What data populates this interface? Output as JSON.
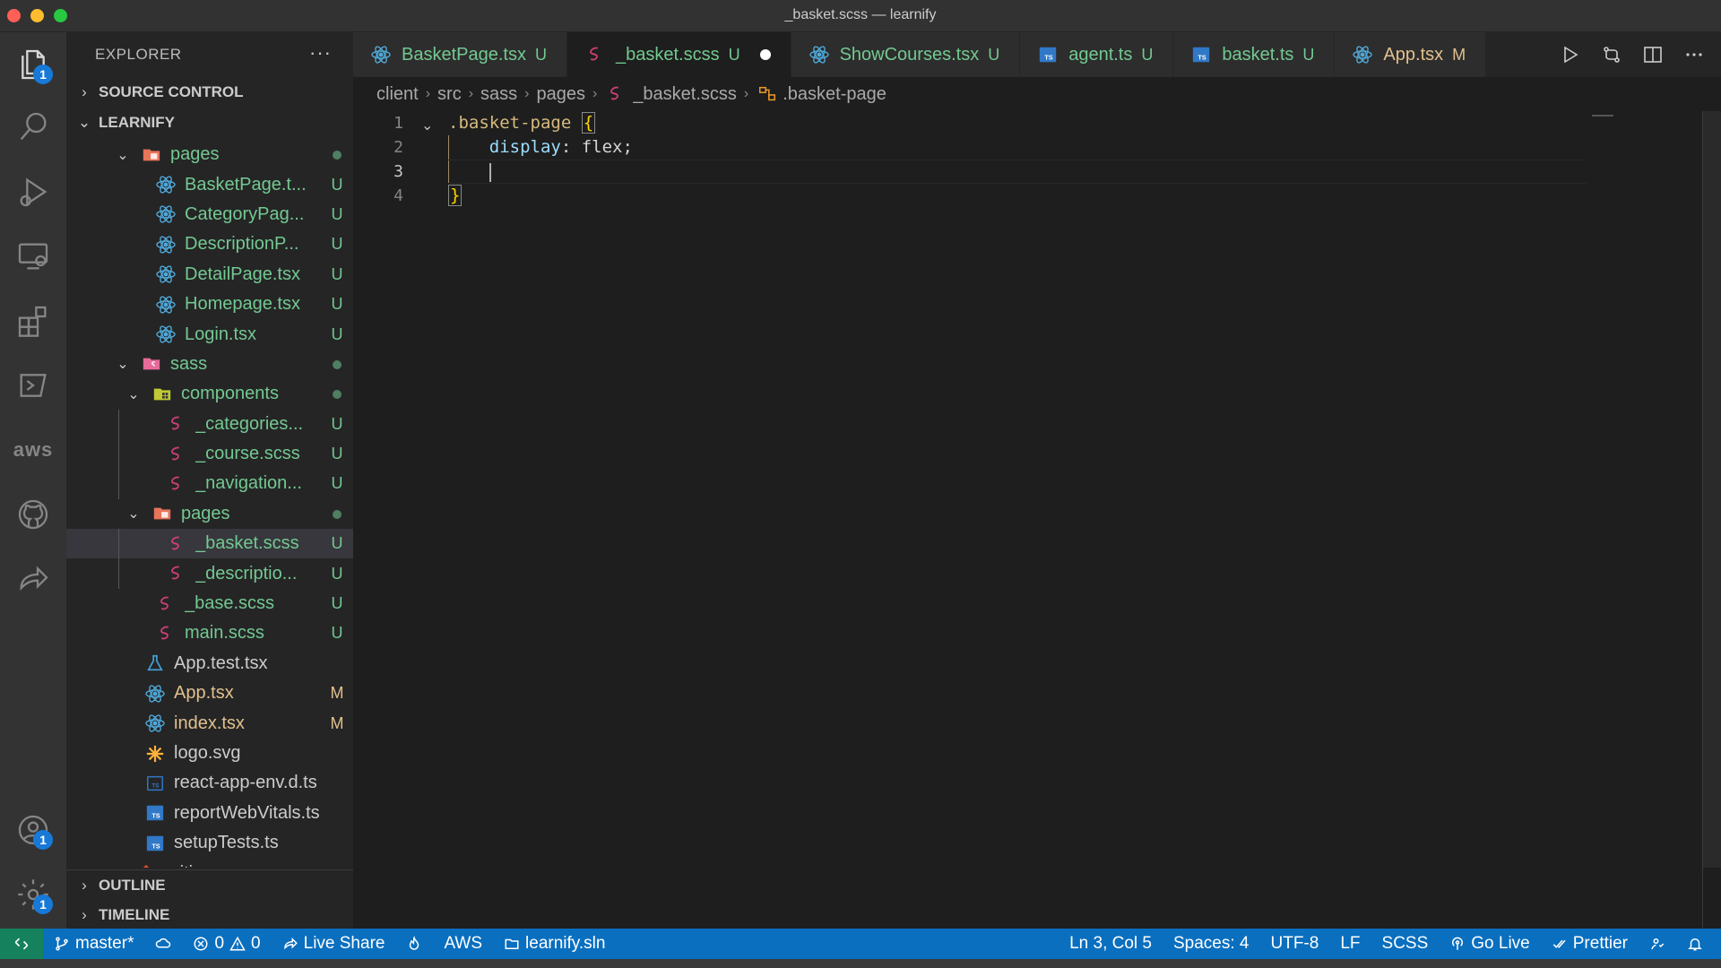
{
  "window": {
    "title": "_basket.scss — learnify"
  },
  "activity_bar": {
    "explorer_badge": "1",
    "aws_label": "aws",
    "accounts_badge": "1",
    "settings_badge": "1"
  },
  "sidebar": {
    "header": "EXPLORER",
    "more": "···",
    "source_control": "SOURCE CONTROL",
    "project": "LEARNIFY",
    "outline": "OUTLINE",
    "timeline": "TIMELINE",
    "tree": [
      {
        "name": "pages",
        "status": "",
        "kind": "folder-pages"
      },
      {
        "name": "BasketPage.t...",
        "status": "U",
        "kind": "react"
      },
      {
        "name": "CategoryPag...",
        "status": "U",
        "kind": "react"
      },
      {
        "name": "DescriptionP...",
        "status": "U",
        "kind": "react"
      },
      {
        "name": "DetailPage.tsx",
        "status": "U",
        "kind": "react"
      },
      {
        "name": "Homepage.tsx",
        "status": "U",
        "kind": "react"
      },
      {
        "name": "Login.tsx",
        "status": "U",
        "kind": "react"
      },
      {
        "name": "sass",
        "status": "",
        "kind": "folder-sass"
      },
      {
        "name": "components",
        "status": "",
        "kind": "folder-components"
      },
      {
        "name": "_categories...",
        "status": "U",
        "kind": "sass"
      },
      {
        "name": "_course.scss",
        "status": "U",
        "kind": "sass"
      },
      {
        "name": "_navigation...",
        "status": "U",
        "kind": "sass"
      },
      {
        "name": "pages",
        "status": "",
        "kind": "folder-pages"
      },
      {
        "name": "_basket.scss",
        "status": "U",
        "kind": "sass"
      },
      {
        "name": "_descriptio...",
        "status": "U",
        "kind": "sass"
      },
      {
        "name": "_base.scss",
        "status": "U",
        "kind": "sass"
      },
      {
        "name": "main.scss",
        "status": "U",
        "kind": "sass"
      },
      {
        "name": "App.test.tsx",
        "status": "",
        "kind": "test"
      },
      {
        "name": "App.tsx",
        "status": "M",
        "kind": "react"
      },
      {
        "name": "index.tsx",
        "status": "M",
        "kind": "react"
      },
      {
        "name": "logo.svg",
        "status": "",
        "kind": "svg"
      },
      {
        "name": "react-app-env.d.ts",
        "status": "",
        "kind": "ts-outline"
      },
      {
        "name": "reportWebVitals.ts",
        "status": "",
        "kind": "ts"
      },
      {
        "name": "setupTests.ts",
        "status": "",
        "kind": "ts"
      },
      {
        "name": ".gitignore",
        "status": "",
        "kind": "git"
      }
    ]
  },
  "tabs": [
    {
      "label": "BasketPage.tsx",
      "status": "U",
      "kind": "react"
    },
    {
      "label": "_basket.scss",
      "status": "U",
      "kind": "sass"
    },
    {
      "label": "ShowCourses.tsx",
      "status": "U",
      "kind": "react"
    },
    {
      "label": "agent.ts",
      "status": "U",
      "kind": "ts"
    },
    {
      "label": "basket.ts",
      "status": "U",
      "kind": "ts"
    },
    {
      "label": "App.tsx",
      "status": "M",
      "kind": "react"
    }
  ],
  "breadcrumb": {
    "parts": [
      "client",
      "src",
      "sass",
      "pages"
    ],
    "file": "_basket.scss",
    "symbol": ".basket-page"
  },
  "editor": {
    "line_numbers": [
      "1",
      "2",
      "3",
      "4"
    ],
    "selector": ".basket-page",
    "open_brace": "{",
    "property": "display",
    "colon": ":",
    "value": " flex;",
    "close_brace": "}"
  },
  "statusbar": {
    "branch": "master*",
    "errors": "0",
    "warnings": "0",
    "live_share": "Live Share",
    "aws": "AWS",
    "solution": "learnify.sln",
    "position": "Ln 3, Col 5",
    "spaces": "Spaces: 4",
    "encoding": "UTF-8",
    "eol": "LF",
    "language": "SCSS",
    "go_live": "Go Live",
    "prettier": "Prettier"
  },
  "colors": {
    "accent": "#0a6fbf",
    "untracked": "#73c991",
    "modified": "#e2c08d",
    "sass": "#cd3f76",
    "react": "#4fa8d8",
    "ts": "#3178c6"
  }
}
